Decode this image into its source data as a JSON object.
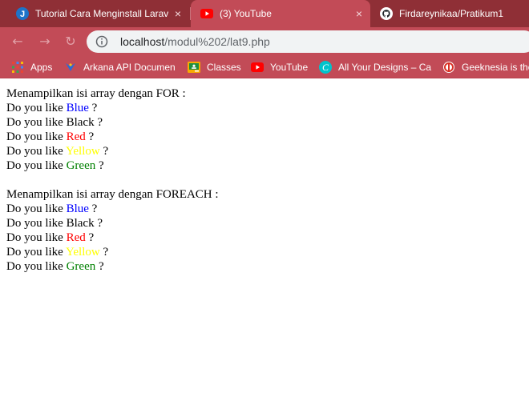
{
  "browser": {
    "tabs": [
      {
        "title": "Tutorial Cara Menginstall Laravel",
        "favicon": "j-logo-icon",
        "active": false
      },
      {
        "title": "(3) YouTube",
        "favicon": "youtube-icon",
        "active": true
      },
      {
        "title": "Firdareynikaa/Pratikum1",
        "favicon": "github-icon",
        "active": false
      }
    ],
    "close_glyph": "×",
    "address": {
      "host": "localhost",
      "path": "/modul%202/lat9.php"
    },
    "bookmarks": [
      {
        "label": "Apps",
        "icon": "apps-grid-icon"
      },
      {
        "label": "Arkana API Documen",
        "icon": "arkana-icon"
      },
      {
        "label": "Classes",
        "icon": "classroom-icon"
      },
      {
        "label": "YouTube",
        "icon": "youtube-icon"
      },
      {
        "label": "All Your Designs – Ca",
        "icon": "canva-icon"
      },
      {
        "label": "Geeknesia is the",
        "icon": "geeknesia-icon"
      }
    ],
    "theme": {
      "tabstrip": "#8f2f36",
      "toolbar": "#c24b57"
    }
  },
  "page": {
    "sections": [
      {
        "heading": "Menampilkan isi array dengan FOR :",
        "items": [
          {
            "prefix": "Do you like ",
            "color_name": "Blue",
            "suffix": " ?",
            "color": "#0000ff"
          },
          {
            "prefix": "Do you like ",
            "color_name": "Black",
            "suffix": " ?",
            "color": "#000000"
          },
          {
            "prefix": "Do you like ",
            "color_name": "Red",
            "suffix": " ?",
            "color": "#ff0000"
          },
          {
            "prefix": "Do you like ",
            "color_name": "Yellow",
            "suffix": " ?",
            "color": "#ffff00"
          },
          {
            "prefix": "Do you like ",
            "color_name": "Green",
            "suffix": " ?",
            "color": "#008000"
          }
        ]
      },
      {
        "heading": "Menampilkan isi array dengan FOREACH :",
        "items": [
          {
            "prefix": "Do you like ",
            "color_name": "Blue",
            "suffix": " ?",
            "color": "#0000ff"
          },
          {
            "prefix": "Do you like ",
            "color_name": "Black",
            "suffix": " ?",
            "color": "#000000"
          },
          {
            "prefix": "Do you like ",
            "color_name": "Red",
            "suffix": " ?",
            "color": "#ff0000"
          },
          {
            "prefix": "Do you like ",
            "color_name": "Yellow",
            "suffix": " ?",
            "color": "#ffff00"
          },
          {
            "prefix": "Do you like ",
            "color_name": "Green",
            "suffix": " ?",
            "color": "#008000"
          }
        ]
      }
    ]
  }
}
